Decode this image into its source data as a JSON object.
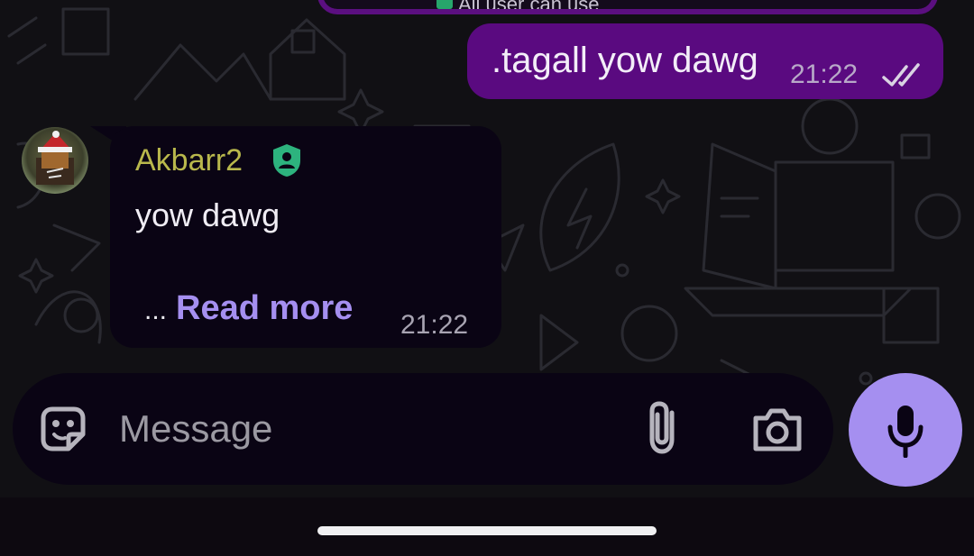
{
  "chat": {
    "prev_message_fragment": "All user can use",
    "outgoing": {
      "text": ".tagall yow dawg",
      "time": "21:22",
      "status_icon": "double-check-icon"
    },
    "incoming": {
      "sender": "Akbarr2",
      "sender_badge_icon": "admin-shield-icon",
      "text": "yow dawg",
      "ellipsis": "...",
      "read_more": "Read more",
      "time": "21:22"
    }
  },
  "composer": {
    "placeholder": "Message",
    "value": "",
    "icons": [
      "sticker-icon",
      "paperclip-icon",
      "camera-icon",
      "microphone-icon"
    ]
  },
  "colors": {
    "outgoing_bubble": "#5a0a80",
    "incoming_bubble": "#0a0414",
    "accent": "#a58ff0",
    "sender_name": "#b9b84c",
    "admin_badge": "#2db37e"
  }
}
